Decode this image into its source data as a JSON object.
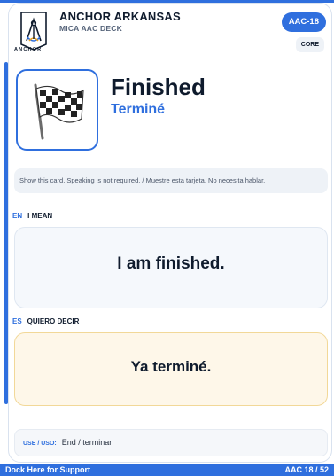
{
  "header": {
    "brand_title": "ANCHOR ARKANSAS",
    "brand_subtitle": "MICA AAC DECK",
    "logo_word": "ANCHOR",
    "card_code": "AAC-18",
    "category": "CORE"
  },
  "symbol": {
    "icon": "checkered-flag-icon",
    "word_en": "Finished",
    "word_fr": "Terminé"
  },
  "instruction": "Show this card. Speaking is not required. / Muestre esta tarjeta. No necesita hablar.",
  "english": {
    "lang_code": "EN",
    "label": "I MEAN",
    "phrase": "I am finished."
  },
  "spanish": {
    "lang_code": "ES",
    "label": "QUIERO DECIR",
    "phrase": "Ya terminé."
  },
  "usage": {
    "label": "USE / USO:",
    "value": "End / terminar"
  },
  "footer": {
    "left": "Dock Here for Support",
    "right": "AAC 18 / 52"
  },
  "colors": {
    "accent": "#2f6fde",
    "spanish_bg": "#fef7e9",
    "spanish_border": "#f2d898"
  }
}
